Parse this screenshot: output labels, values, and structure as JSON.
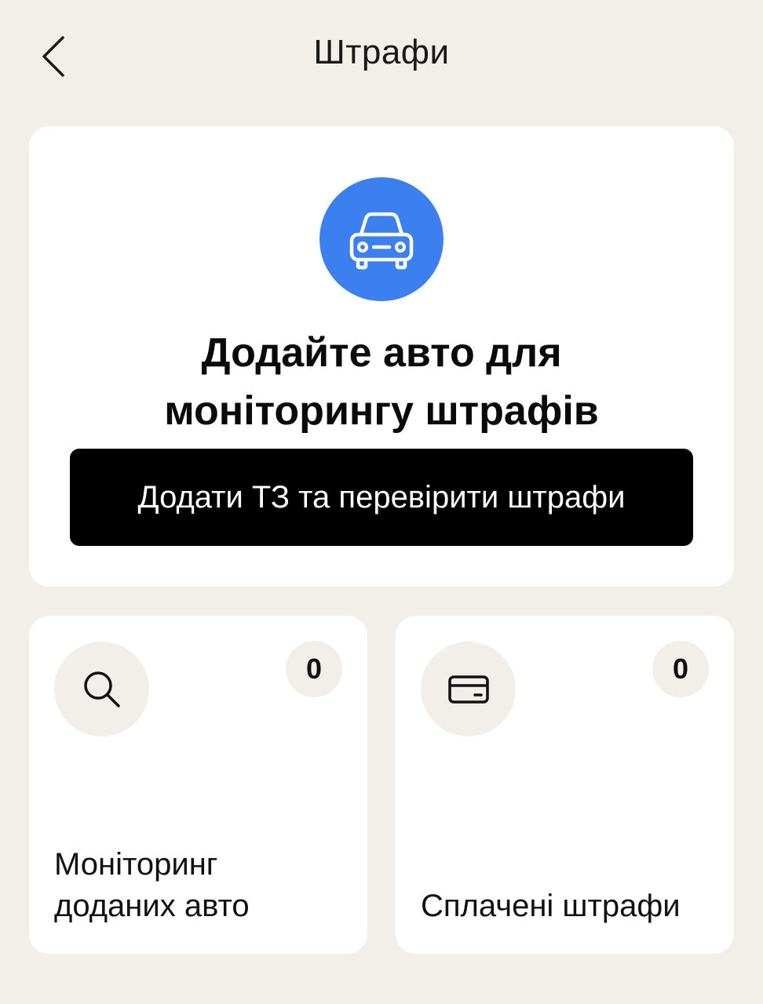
{
  "header": {
    "title": "Штрафи",
    "back_icon": "chevron-left-icon"
  },
  "hero": {
    "icon": "car-icon",
    "icon_bg_color": "#3c80f0",
    "title_line1": "Додайте авто для",
    "title_line2": "моніторингу штрафів",
    "button_label": "Додати ТЗ та перевірити штрафи"
  },
  "tiles": [
    {
      "icon": "search-icon",
      "count": "0",
      "label_line1": "Моніторинг",
      "label_line2": "доданих авто"
    },
    {
      "icon": "card-icon",
      "count": "0",
      "label_line1": "Сплачені штрафи",
      "label_line2": ""
    }
  ],
  "colors": {
    "background": "#f2efea",
    "card": "#ffffff",
    "accent": "#3c80f0",
    "button": "#000000"
  }
}
